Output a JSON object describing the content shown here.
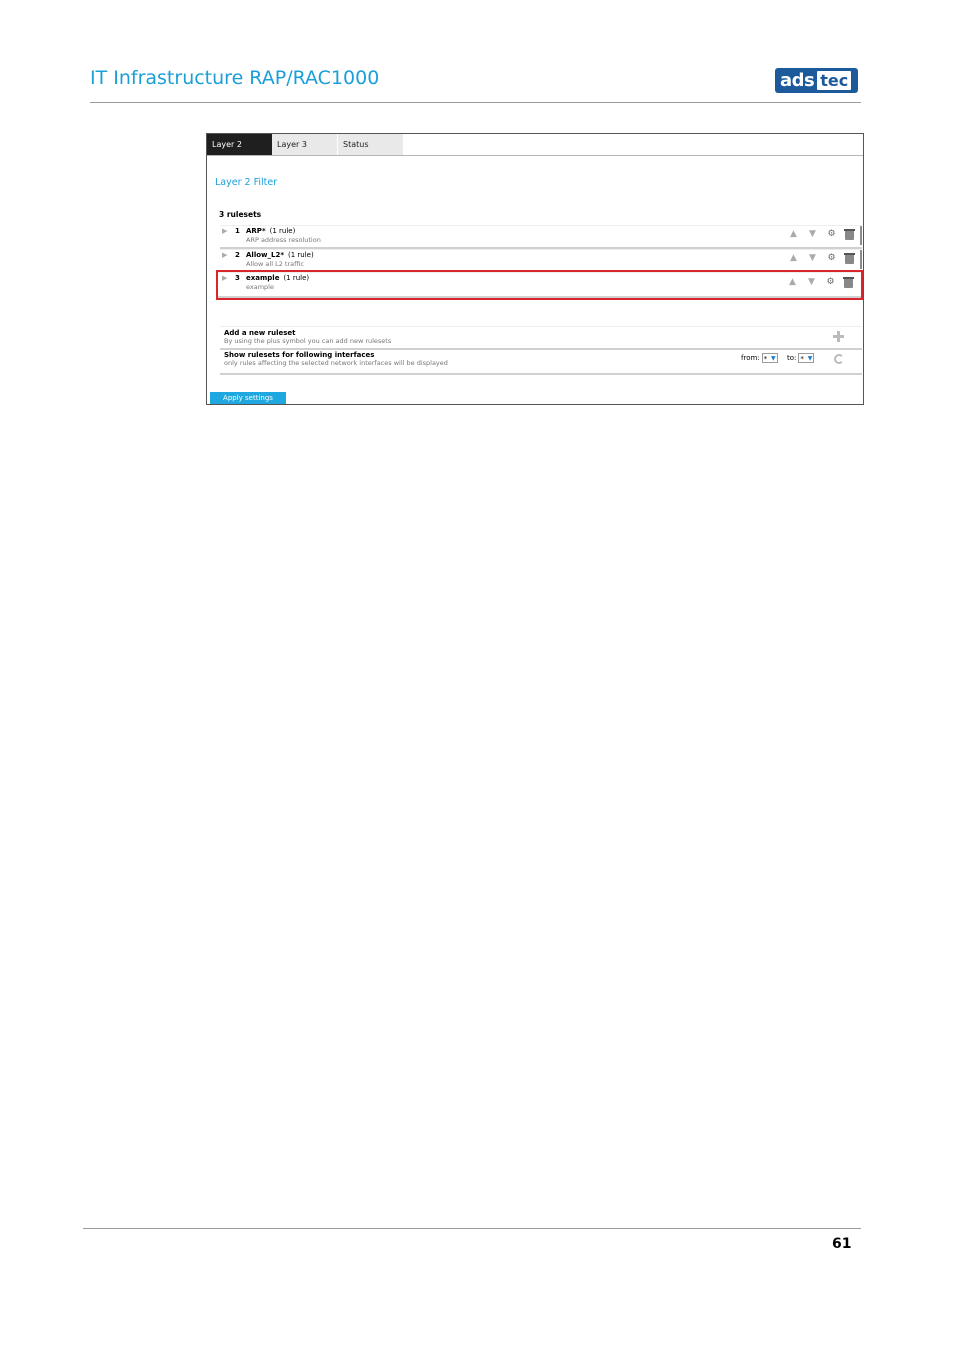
{
  "header": {
    "title": "IT Infrastructure RAP/RAC1000",
    "logo_text_1": "ads",
    "logo_text_2": "tec"
  },
  "tabs": [
    {
      "label": "Layer 2",
      "active": true
    },
    {
      "label": "Layer 3",
      "active": false
    },
    {
      "label": "Status",
      "active": false
    }
  ],
  "section_title": "Layer 2 Filter",
  "ruleset_count": "3 rulesets",
  "rulesets": [
    {
      "num": "1",
      "name": "ARP*",
      "count": "(1 rule)",
      "desc": "ARP address resolution",
      "selected": false
    },
    {
      "num": "2",
      "name": "Allow_L2*",
      "count": "(1 rule)",
      "desc": "Allow all L2 traffic",
      "selected": false
    },
    {
      "num": "3",
      "name": "example",
      "count": "(1 rule)",
      "desc": "example",
      "selected": true
    }
  ],
  "add_ruleset": {
    "title": "Add a new ruleset",
    "subtitle": "By using the plus symbol you can add new rulesets"
  },
  "show_rulesets": {
    "title": "Show rulesets for following interfaces",
    "subtitle": "only rules affecting the selected network interfaces will be displayed",
    "from_label": "from:",
    "from_value": "*",
    "to_label": "to:",
    "to_value": "*"
  },
  "apply_label": "Apply settings",
  "page_number": "61",
  "colors": {
    "accent": "#1a9fd8",
    "selection": "#d9262c",
    "logo": "#1c5a9c"
  }
}
